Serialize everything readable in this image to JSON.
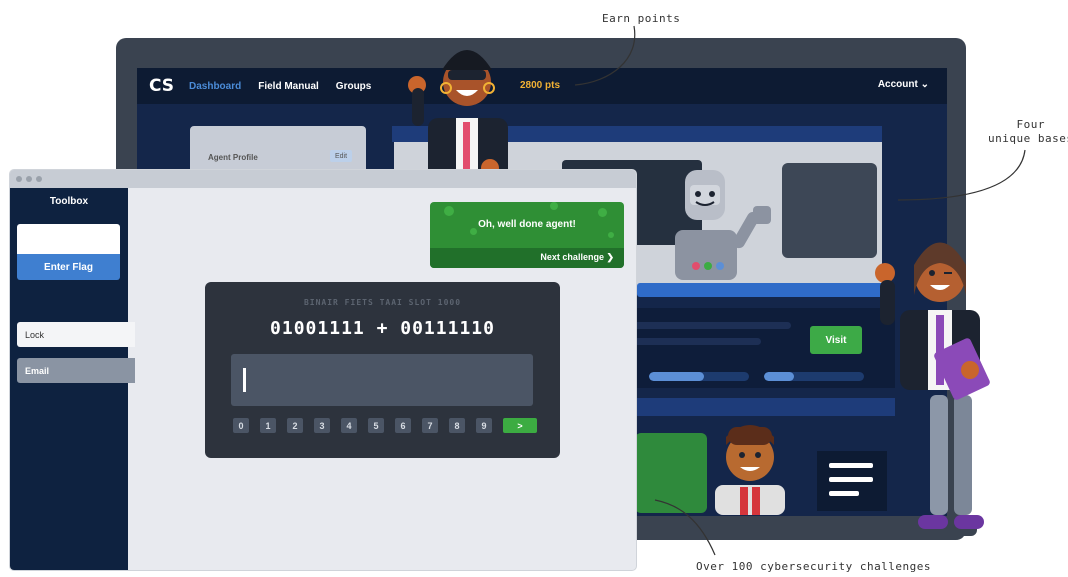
{
  "annotations": {
    "earn_points": "Earn points",
    "four_bases": "Four\nunique bases",
    "challenges": "Over 100 cybersecurity challenges"
  },
  "app": {
    "logo": "CS",
    "nav": [
      "Dashboard",
      "Field Manual",
      "Groups"
    ],
    "points": "2800 pts",
    "account": "Account ⌄",
    "agent_profile": "Agent Profile",
    "edit": "Edit",
    "visit": "Visit",
    "progress": [
      0.55,
      0.3
    ]
  },
  "toolbox": {
    "title": "Toolbox",
    "flag_placeholder": "",
    "enter_flag": "Enter Flag",
    "items": [
      "Lock",
      "Email"
    ]
  },
  "toast": {
    "message": "Oh, well done agent!",
    "next": "Next challenge ❯"
  },
  "puzzle": {
    "hint": "BINAIR FIETS TAAI SLOT 1000",
    "equation": "01001111 + 00111110",
    "keys": [
      "0",
      "1",
      "2",
      "3",
      "4",
      "5",
      "6",
      "7",
      "8",
      "9"
    ],
    "submit": ">"
  },
  "colors": {
    "navy": "#0e2240",
    "accent_blue": "#3f7fd0",
    "green": "#2f8f35",
    "gold": "#f2b234"
  }
}
